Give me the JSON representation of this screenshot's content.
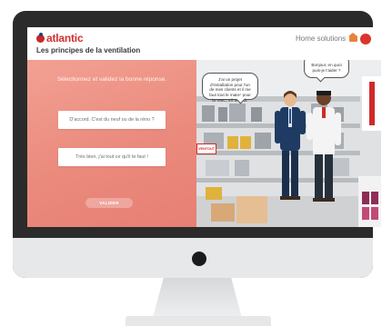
{
  "app": {
    "logo_text": "atlantic",
    "page_title": "Les principes de la ventilation",
    "home_link": "Home solutions",
    "home_icon": "house-icon",
    "close_icon": "close-icon"
  },
  "quiz": {
    "instruction": "Sélectionnez et validez la bonne réponse.",
    "answers": [
      "D'accord. C'est du neuf ou de la réno ?",
      "Très bien, j'ai tout ce qu'il te faut !"
    ],
    "validate_label": "VALIDER"
  },
  "scene": {
    "bubble_left": "J'ai un projet d'installation pour l'un de mes clients et il me faut tout le matos pour la VMC, s'il te plaît.",
    "bubble_right": "Bonjour, en quoi puis-je t'aider ?",
    "sign": "VENTOUT"
  },
  "colors": {
    "brand_red": "#d32f2f",
    "quiz_bg": "#ea8a7d",
    "close_btn": "#d9352e",
    "home_icon": "#e8833a"
  }
}
